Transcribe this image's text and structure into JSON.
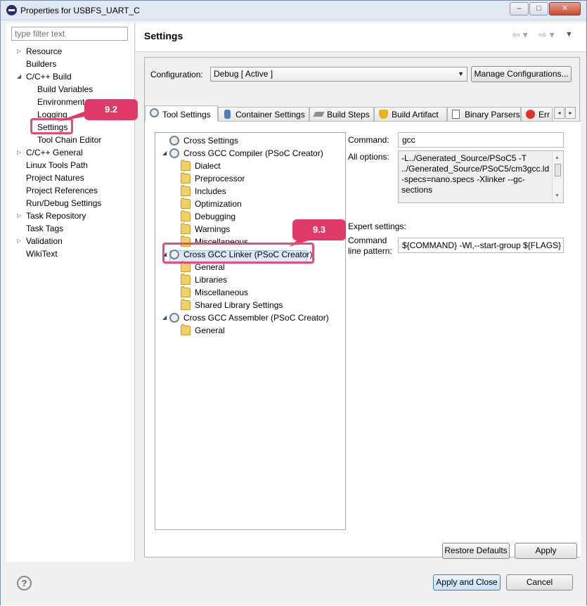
{
  "window": {
    "title": "Properties for USBFS_UART_C",
    "min_glyph": "–",
    "max_glyph": "□",
    "close_glyph": "✕"
  },
  "filter": {
    "placeholder": "type filter text"
  },
  "nav": {
    "items": [
      {
        "label": "Resource",
        "arrow": "▷",
        "level": 0
      },
      {
        "label": "Builders",
        "arrow": "",
        "level": 0
      },
      {
        "label": "C/C++ Build",
        "arrow": "◢",
        "level": 0
      },
      {
        "label": "Build Variables",
        "arrow": "",
        "level": 1
      },
      {
        "label": "Environment",
        "arrow": "",
        "level": 1
      },
      {
        "label": "Logging",
        "arrow": "",
        "level": 1
      },
      {
        "label": "Settings",
        "arrow": "",
        "level": 1
      },
      {
        "label": "Tool Chain Editor",
        "arrow": "",
        "level": 1
      },
      {
        "label": "C/C++ General",
        "arrow": "▷",
        "level": 0
      },
      {
        "label": "Linux Tools Path",
        "arrow": "",
        "level": 0
      },
      {
        "label": "Project Natures",
        "arrow": "",
        "level": 0
      },
      {
        "label": "Project References",
        "arrow": "",
        "level": 0
      },
      {
        "label": "Run/Debug Settings",
        "arrow": "",
        "level": 0
      },
      {
        "label": "Task Repository",
        "arrow": "▷",
        "level": 0
      },
      {
        "label": "Task Tags",
        "arrow": "",
        "level": 0
      },
      {
        "label": "Validation",
        "arrow": "▷",
        "level": 0
      },
      {
        "label": "WikiText",
        "arrow": "",
        "level": 0
      }
    ]
  },
  "header": {
    "title": "Settings",
    "back_glyph": "⇦ ▾",
    "fwd_glyph": "⇨ ▾",
    "menu_glyph": "▼"
  },
  "config": {
    "label": "Configuration:",
    "value": "Debug  [ Active ]",
    "manage_label": "Manage Configurations..."
  },
  "tabs": [
    {
      "label": "Tool Settings"
    },
    {
      "label": "Container Settings"
    },
    {
      "label": "Build Steps"
    },
    {
      "label": "Build Artifact"
    },
    {
      "label": "Binary Parsers"
    },
    {
      "label": "Err"
    }
  ],
  "tab_scroll": {
    "left": "◂",
    "right": "▸"
  },
  "tree": {
    "items": [
      {
        "label": "Cross Settings",
        "icon": "gear-icon",
        "level": 0,
        "twisty": ""
      },
      {
        "label": "Cross GCC Compiler (PSoC Creator)",
        "icon": "gear-icon",
        "level": 0,
        "twisty": "◢"
      },
      {
        "label": "Dialect",
        "icon": "folder-icon",
        "level": 1,
        "twisty": ""
      },
      {
        "label": "Preprocessor",
        "icon": "folder-icon",
        "level": 1,
        "twisty": ""
      },
      {
        "label": "Includes",
        "icon": "folder-icon",
        "level": 1,
        "twisty": ""
      },
      {
        "label": "Optimization",
        "icon": "folder-icon",
        "level": 1,
        "twisty": ""
      },
      {
        "label": "Debugging",
        "icon": "folder-icon",
        "level": 1,
        "twisty": ""
      },
      {
        "label": "Warnings",
        "icon": "folder-icon",
        "level": 1,
        "twisty": ""
      },
      {
        "label": "Miscellaneous",
        "icon": "folder-icon",
        "level": 1,
        "twisty": ""
      },
      {
        "label": "Cross GCC Linker (PSoC Creator)",
        "icon": "gear-icon",
        "level": 0,
        "twisty": "◢"
      },
      {
        "label": "General",
        "icon": "folder-icon",
        "level": 1,
        "twisty": ""
      },
      {
        "label": "Libraries",
        "icon": "folder-icon",
        "level": 1,
        "twisty": ""
      },
      {
        "label": "Miscellaneous",
        "icon": "folder-icon",
        "level": 1,
        "twisty": ""
      },
      {
        "label": "Shared Library Settings",
        "icon": "folder-icon",
        "level": 1,
        "twisty": ""
      },
      {
        "label": "Cross GCC Assembler (PSoC Creator)",
        "icon": "gear-icon",
        "level": 0,
        "twisty": "◢"
      },
      {
        "label": "General",
        "icon": "folder-icon",
        "level": 1,
        "twisty": ""
      }
    ]
  },
  "detail": {
    "command_label": "Command:",
    "command_value": "gcc",
    "all_options_label": "All options:",
    "all_options_lines": [
      "-L../Generated_Source/PSoC5 -T",
      "../Generated_Source/PSoC5/cm3gcc.ld",
      "-specs=nano.specs -Xlinker --gc-",
      "sections"
    ],
    "expert_label": "Expert settings:",
    "pattern_label_1": "Command",
    "pattern_label_2": "line pattern:",
    "pattern_value": "${COMMAND} -Wl,--start-group ${FLAGS}"
  },
  "annotations": {
    "callout_settings": "9.2",
    "callout_linker": "9.3",
    "color": "#e03b68"
  },
  "buttons": {
    "restore_defaults": "Restore Defaults",
    "apply": "Apply",
    "apply_close": "Apply and Close",
    "cancel": "Cancel"
  },
  "help": {
    "glyph": "?"
  }
}
